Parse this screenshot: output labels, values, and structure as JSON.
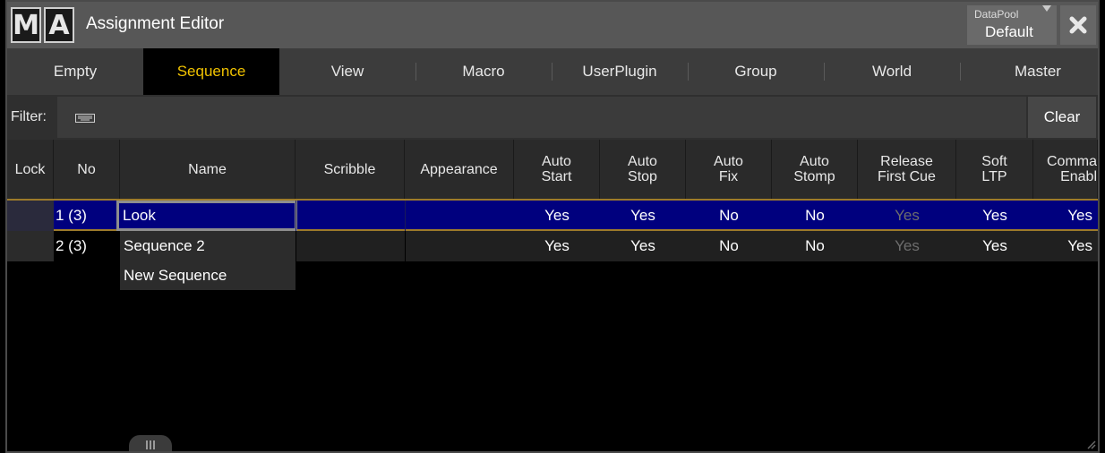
{
  "window": {
    "logo": [
      "M",
      "A"
    ],
    "title": "Assignment Editor",
    "datapool": {
      "label": "DataPool",
      "value": "Default"
    },
    "close_icon": "close-x-icon"
  },
  "tabs": [
    {
      "label": "Empty",
      "active": false
    },
    {
      "label": "Sequence",
      "active": true
    },
    {
      "label": "View",
      "active": false
    },
    {
      "label": "Macro",
      "active": false
    },
    {
      "label": "UserPlugin",
      "active": false
    },
    {
      "label": "Group",
      "active": false
    },
    {
      "label": "World",
      "active": false
    },
    {
      "label": "Master",
      "active": false
    }
  ],
  "filter": {
    "label": "Filter:",
    "icon": "keyboard-icon",
    "clear_label": "Clear"
  },
  "columns": {
    "lock": "Lock",
    "no": "No",
    "name": "Name",
    "scribble": "Scribble",
    "appearance": "Appearance",
    "auto_start": "Auto\nStart",
    "auto_stop": "Auto\nStop",
    "auto_fix": "Auto\nFix",
    "auto_stomp": "Auto\nStomp",
    "release_first_cue": "Release\nFirst Cue",
    "soft_ltp": "Soft\nLTP",
    "command_enable": "Comma\nEnabl"
  },
  "rows": [
    {
      "no": "1 (3)",
      "name": "Look",
      "auto_start": "Yes",
      "auto_stop": "Yes",
      "auto_fix": "No",
      "auto_stomp": "No",
      "release_first_cue": "Yes",
      "soft_ltp": "Yes",
      "command_enable": "Yes"
    },
    {
      "no": "2 (3)",
      "name": "Sequence 2",
      "auto_start": "Yes",
      "auto_stop": "Yes",
      "auto_fix": "No",
      "auto_stomp": "No",
      "release_first_cue": "Yes",
      "soft_ltp": "Yes",
      "command_enable": "Yes"
    }
  ],
  "new_item": "New Sequence",
  "colors": {
    "accent": "#f0c200",
    "selection": "#00007e",
    "divider": "#9d7b2a"
  }
}
